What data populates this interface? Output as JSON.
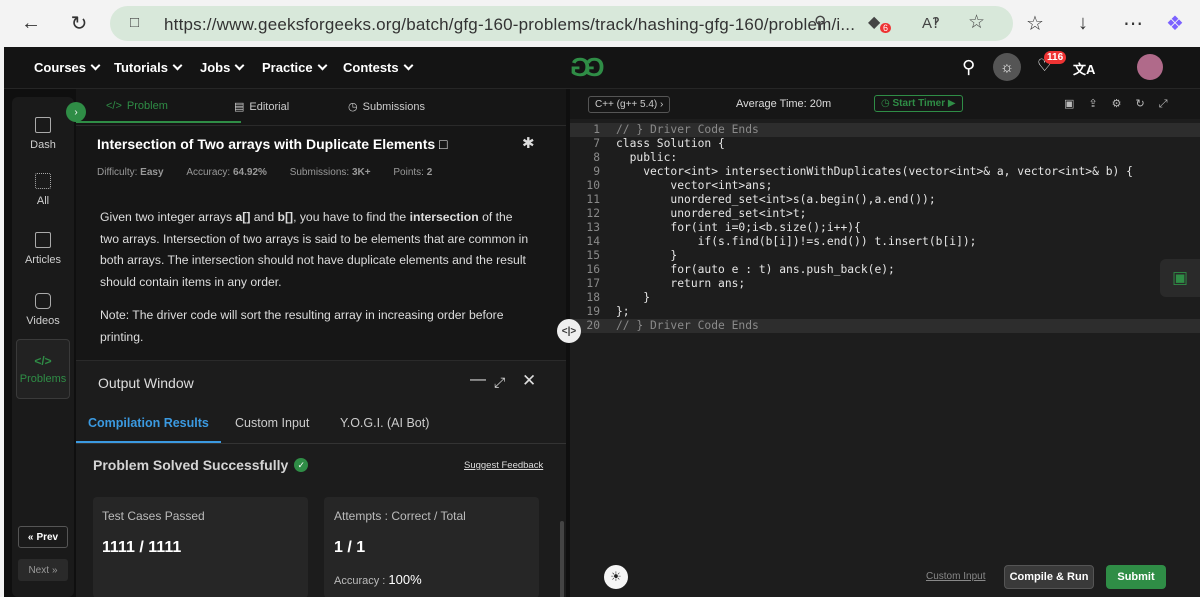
{
  "browser": {
    "url": "https://www.geeksforgeeks.org/batch/gfg-160-problems/track/hashing-gfg-160/problem/i...",
    "badge_count": "6"
  },
  "nav": {
    "items": [
      "Courses",
      "Tutorials",
      "Jobs",
      "Practice",
      "Contests"
    ],
    "logo": "GG",
    "notification_count": "116"
  },
  "sidebar": {
    "items": [
      "Dash",
      "All",
      "Articles",
      "Videos",
      "Problems"
    ],
    "prev_label": "Prev",
    "next_label": "Next"
  },
  "problem": {
    "tabs": [
      "Problem",
      "Editorial",
      "Submissions"
    ],
    "title": "Intersection of Two arrays with Duplicate Elements",
    "difficulty_label": "Difficulty:",
    "difficulty": "Easy",
    "accuracy_label": "Accuracy:",
    "accuracy": "64.92%",
    "submissions_label": "Submissions:",
    "submissions": "3K+",
    "points_label": "Points:",
    "points": "2",
    "desc_1": "Given two integer arrays ",
    "desc_a": "a[]",
    "desc_and": " and ",
    "desc_b": "b[]",
    "desc_2": ", you have to find the ",
    "desc_inter": "intersection",
    "desc_3": " of the two arrays. Intersection of two arrays is said to be elements that are common in both arrays. The intersection should not have duplicate elements and the result should contain items in any order.",
    "note": "Note: The driver code will sort the resulting array in increasing order before printing."
  },
  "output": {
    "title": "Output Window",
    "tabs": [
      "Compilation Results",
      "Custom Input",
      "Y.O.G.I. (AI Bot)"
    ],
    "status": "Problem Solved Successfully",
    "feedback": "Suggest Feedback",
    "test_label": "Test Cases Passed",
    "test_value": "1111 / 1111",
    "attempts_label": "Attempts : Correct / Total",
    "attempts_value": "1 / 1",
    "acc_label": "Accuracy :",
    "acc_value": "100%"
  },
  "editor": {
    "language": "C++ (g++ 5.4)",
    "avg_time": "Average Time: 20m",
    "timer": "Start Timer",
    "lines": [
      {
        "n": "1",
        "t": "// } Driver Code Ends"
      },
      {
        "n": "7",
        "t": "class Solution {"
      },
      {
        "n": "8",
        "t": "  public:"
      },
      {
        "n": "9",
        "t": "    vector<int> intersectionWithDuplicates(vector<int>& a, vector<int>& b) {"
      },
      {
        "n": "10",
        "t": "        vector<int>ans;"
      },
      {
        "n": "11",
        "t": "        unordered_set<int>s(a.begin(),a.end());"
      },
      {
        "n": "12",
        "t": "        unordered_set<int>t;"
      },
      {
        "n": "13",
        "t": "        for(int i=0;i<b.size();i++){"
      },
      {
        "n": "14",
        "t": "            if(s.find(b[i])!=s.end()) t.insert(b[i]);"
      },
      {
        "n": "15",
        "t": "        }"
      },
      {
        "n": "16",
        "t": "        for(auto e : t) ans.push_back(e);"
      },
      {
        "n": "17",
        "t": "        return ans;"
      },
      {
        "n": "18",
        "t": "    }"
      },
      {
        "n": "19",
        "t": "};"
      },
      {
        "n": "20",
        "t": "// } Driver Code Ends"
      }
    ],
    "custom_input": "Custom Input",
    "compile": "Compile & Run",
    "submit": "Submit"
  },
  "colors": {
    "accent_green": "#2f8d46",
    "link_blue": "#3b9ae1",
    "success": "#2f8d46"
  }
}
